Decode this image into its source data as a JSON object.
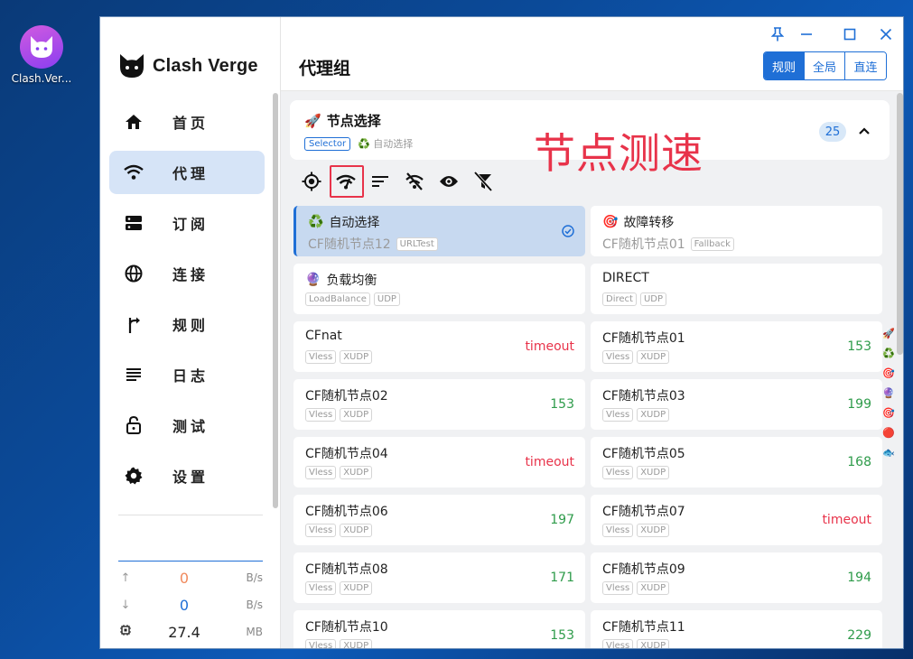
{
  "desktop": {
    "icon_label": "Clash.Ver..."
  },
  "app": {
    "name": "Clash Verge"
  },
  "nav": [
    {
      "id": "home",
      "label": "首页"
    },
    {
      "id": "proxy",
      "label": "代理"
    },
    {
      "id": "subscribe",
      "label": "订阅"
    },
    {
      "id": "connections",
      "label": "连接"
    },
    {
      "id": "rules",
      "label": "规则"
    },
    {
      "id": "logs",
      "label": "日志"
    },
    {
      "id": "test",
      "label": "测试"
    },
    {
      "id": "settings",
      "label": "设置"
    }
  ],
  "traffic": {
    "up": {
      "arrow": "↑",
      "value": "0",
      "unit": "B/s",
      "color": "#f08a5d"
    },
    "down": {
      "arrow": "↓",
      "value": "0",
      "unit": "B/s",
      "color": "#1f6fd6"
    },
    "memory": {
      "value": "27.4",
      "unit": "MB"
    }
  },
  "header": {
    "title": "代理组",
    "modes": [
      "规则",
      "全局",
      "直连"
    ],
    "active_mode": "规则"
  },
  "group": {
    "emoji": "🚀",
    "name": "节点选择",
    "type_tag": "Selector",
    "now": "♻️ 自动选择",
    "count": "25"
  },
  "annotation": "节点测速",
  "toolbar": [
    "locate-icon",
    "delay-check-icon",
    "sort-icon",
    "hide-unavailable-icon",
    "eye-icon",
    "filter-off-icon"
  ],
  "proxies": [
    {
      "emoji": "♻️",
      "name": "自动选择",
      "now": "CF随机节点12",
      "tags": [
        "URLTest"
      ],
      "delay": "",
      "selected": true
    },
    {
      "emoji": "🎯",
      "name": "故障转移",
      "now": "CF随机节点01",
      "tags": [
        "Fallback"
      ],
      "delay": "",
      "selected": false
    },
    {
      "emoji": "🔮",
      "name": "负载均衡",
      "now": "",
      "tags": [
        "LoadBalance",
        "UDP"
      ],
      "delay": "",
      "selected": false
    },
    {
      "emoji": "",
      "name": "DIRECT",
      "now": "",
      "tags": [
        "Direct",
        "UDP"
      ],
      "delay": "",
      "selected": false
    },
    {
      "emoji": "",
      "name": "CFnat",
      "now": "",
      "tags": [
        "Vless",
        "XUDP"
      ],
      "delay": "timeout",
      "selected": false
    },
    {
      "emoji": "",
      "name": "CF随机节点01",
      "now": "",
      "tags": [
        "Vless",
        "XUDP"
      ],
      "delay": "153",
      "selected": false
    },
    {
      "emoji": "",
      "name": "CF随机节点02",
      "now": "",
      "tags": [
        "Vless",
        "XUDP"
      ],
      "delay": "153",
      "selected": false
    },
    {
      "emoji": "",
      "name": "CF随机节点03",
      "now": "",
      "tags": [
        "Vless",
        "XUDP"
      ],
      "delay": "199",
      "selected": false
    },
    {
      "emoji": "",
      "name": "CF随机节点04",
      "now": "",
      "tags": [
        "Vless",
        "XUDP"
      ],
      "delay": "timeout",
      "selected": false
    },
    {
      "emoji": "",
      "name": "CF随机节点05",
      "now": "",
      "tags": [
        "Vless",
        "XUDP"
      ],
      "delay": "168",
      "selected": false
    },
    {
      "emoji": "",
      "name": "CF随机节点06",
      "now": "",
      "tags": [
        "Vless",
        "XUDP"
      ],
      "delay": "197",
      "selected": false
    },
    {
      "emoji": "",
      "name": "CF随机节点07",
      "now": "",
      "tags": [
        "Vless",
        "XUDP"
      ],
      "delay": "timeout",
      "selected": false
    },
    {
      "emoji": "",
      "name": "CF随机节点08",
      "now": "",
      "tags": [
        "Vless",
        "XUDP"
      ],
      "delay": "171",
      "selected": false
    },
    {
      "emoji": "",
      "name": "CF随机节点09",
      "now": "",
      "tags": [
        "Vless",
        "XUDP"
      ],
      "delay": "194",
      "selected": false
    },
    {
      "emoji": "",
      "name": "CF随机节点10",
      "now": "",
      "tags": [
        "Vless",
        "XUDP"
      ],
      "delay": "153",
      "selected": false
    },
    {
      "emoji": "",
      "name": "CF随机节点11",
      "now": "",
      "tags": [
        "Vless",
        "XUDP"
      ],
      "delay": "229",
      "selected": false
    }
  ],
  "side_index": [
    "🚀",
    "♻️",
    "🎯",
    "🔮",
    "🎯",
    "🔴",
    "🐟"
  ],
  "colors": {
    "accent": "#1f6fd6",
    "ok": "#2e9b4a",
    "bad": "#e8334a"
  }
}
